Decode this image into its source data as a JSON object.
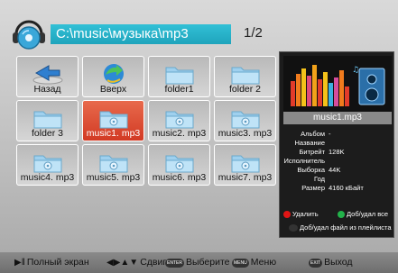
{
  "header": {
    "path": "C:\\music\\музыка\\mp3",
    "page": "1/2"
  },
  "grid": {
    "items": [
      {
        "label": "Назад",
        "kind": "back"
      },
      {
        "label": "Вверх",
        "kind": "up"
      },
      {
        "label": "folder1",
        "kind": "folder"
      },
      {
        "label": "folder 2",
        "kind": "folder"
      },
      {
        "label": "folder 3",
        "kind": "folder"
      },
      {
        "label": "music1. mp3",
        "kind": "music",
        "selected": true
      },
      {
        "label": "music2. mp3",
        "kind": "music"
      },
      {
        "label": "music3. mp3",
        "kind": "music"
      },
      {
        "label": "music4. mp3",
        "kind": "music"
      },
      {
        "label": "music5. mp3",
        "kind": "music"
      },
      {
        "label": "music6. mp3",
        "kind": "music"
      },
      {
        "label": "music7. mp3",
        "kind": "music"
      }
    ]
  },
  "info": {
    "filename": "music1.mp3",
    "meta": [
      {
        "key": "Альбом",
        "value": "-"
      },
      {
        "key": "Название",
        "value": ""
      },
      {
        "key": "Битрейт",
        "value": "128K"
      },
      {
        "key": "Исполнитель",
        "value": ""
      },
      {
        "key": "Выборка",
        "value": "44K"
      },
      {
        "key": "Год",
        "value": ""
      },
      {
        "key": "Размер",
        "value": "4160 кБайт"
      }
    ],
    "actions": {
      "delete": "Удалить",
      "add_all": "Доб/удал все",
      "add_remove": "Доб/удал файл из плейлиста"
    }
  },
  "footer": {
    "fullscreen": "Полный экран",
    "shift": "Сдвиг",
    "select": "Выберите",
    "menu": "Меню",
    "exit": "Выход",
    "keys": {
      "enter": "ENTER",
      "menu": "MENU",
      "exit": "EXIT"
    }
  },
  "colors": {
    "accent": "#1fa4bc",
    "selected": "#d23a24",
    "delete_dot": "#e01515",
    "add_all_dot": "#22b24a"
  }
}
